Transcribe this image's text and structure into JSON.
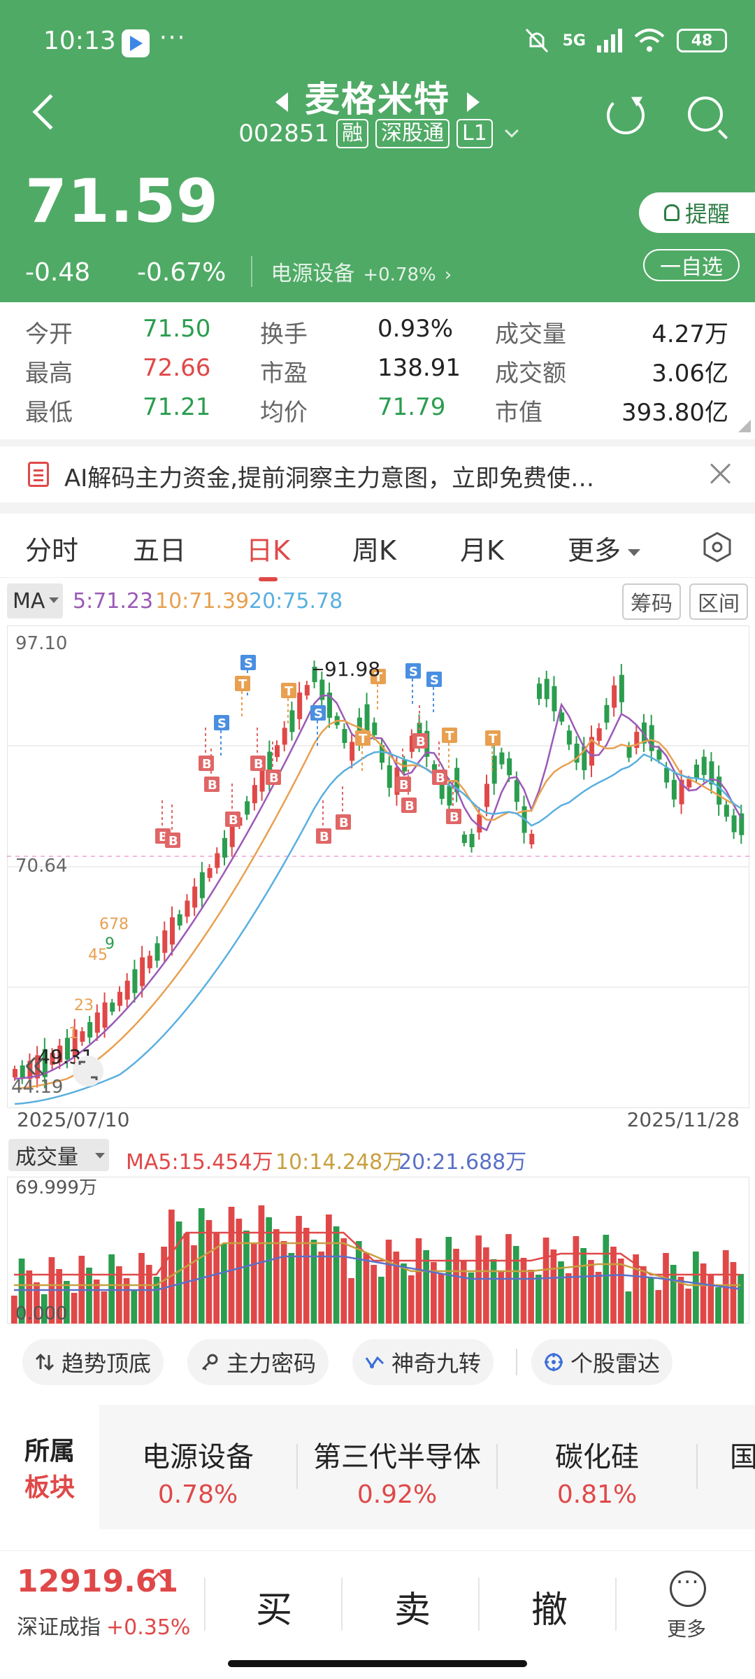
{
  "status_bar": {
    "time": "10:13",
    "dots": "···",
    "network": "5G",
    "battery": "48"
  },
  "header": {
    "stock_name": "麦格米特",
    "stock_code": "002851",
    "tags": [
      "融",
      "深股通",
      "L1"
    ],
    "price": "71.59",
    "change": "-0.48",
    "change_pct": "-0.67%",
    "sector": "电源设备",
    "sector_pct": "+0.78%",
    "sector_arrow": "›",
    "remind_label": "提醒",
    "fav_label": "一自选"
  },
  "stats": [
    [
      {
        "label": "今开",
        "value": "71.50",
        "color": "green"
      },
      {
        "label": "换手",
        "value": "0.93%",
        "color": "dark"
      },
      {
        "label": "成交量",
        "value": "4.27万",
        "color": "dark"
      }
    ],
    [
      {
        "label": "最高",
        "value": "72.66",
        "color": "red"
      },
      {
        "label": "市盈",
        "value": "138.91",
        "color": "dark"
      },
      {
        "label": "成交额",
        "value": "3.06亿",
        "color": "dark"
      }
    ],
    [
      {
        "label": "最低",
        "value": "71.21",
        "color": "green"
      },
      {
        "label": "均价",
        "value": "71.79",
        "color": "green"
      },
      {
        "label": "市值",
        "value": "393.80亿",
        "color": "dark"
      }
    ]
  ],
  "banner": {
    "text": "AI解码主力资金,提前洞察主力意图，立即免费使…"
  },
  "tabs": [
    "分时",
    "五日",
    "日K",
    "周K",
    "月K",
    "更多"
  ],
  "active_tab": "日K",
  "ma": {
    "label": "MA",
    "ma5": "5:71.23",
    "ma10": "10:71.39",
    "ma20": "20:75.78",
    "chips_label": "筹码",
    "range_label": "区间"
  },
  "kline": {
    "y_top": "97.10",
    "y_mid": "70.64",
    "y_bottom": "44.19",
    "high_label": "91.98",
    "low_label": "49.31",
    "start_date": "2025/07/10",
    "end_date": "2025/11/28",
    "nine_turn_labels": [
      "1",
      "23",
      "45",
      "678",
      "9"
    ],
    "marker_b": "B",
    "marker_s": "S",
    "marker_t": "T"
  },
  "volume": {
    "label": "成交量",
    "ma5": "MA5:15.454万",
    "ma10": "10:14.248万",
    "ma20": "20:21.688万",
    "max": "69.999万",
    "zero": "0.000"
  },
  "tools": [
    "趋势顶底",
    "主力密码",
    "神奇九转",
    "个股雷达"
  ],
  "sectors": {
    "label_top": "所属",
    "label_bottom": "板块",
    "items": [
      {
        "name": "电源设备",
        "pct": "0.78%"
      },
      {
        "name": "第三代半导体",
        "pct": "0.92%"
      },
      {
        "name": "碳化硅",
        "pct": "0.81%"
      },
      {
        "name": "国",
        "pct": ""
      }
    ]
  },
  "bottom": {
    "index_value": "12919.61",
    "index_name": "深证成指",
    "index_pct": "+0.35%",
    "buy": "买",
    "sell": "卖",
    "cancel": "撤",
    "more": "更多"
  },
  "colors": {
    "header_green": "#4faa65",
    "up_red": "#e04848",
    "down_green": "#2a9d4e",
    "ma5": "#9b59b6",
    "ma10": "#e8a050",
    "ma20": "#5aafe0"
  }
}
